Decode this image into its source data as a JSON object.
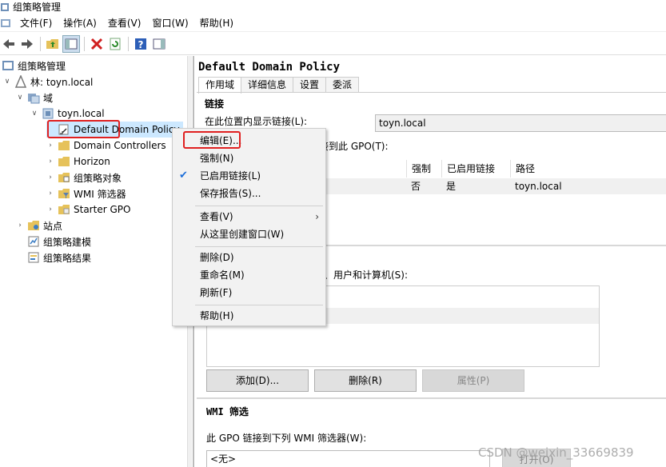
{
  "window": {
    "title": "组策略管理"
  },
  "menubar": {
    "items": [
      "文件(F)",
      "操作(A)",
      "查看(V)",
      "窗口(W)",
      "帮助(H)"
    ]
  },
  "toolbar": {
    "buttons": [
      "back-icon",
      "forward-icon",
      "up-folder-icon",
      "show-hide-tree-icon",
      "delete-icon",
      "refresh-icon",
      "help-icon",
      "properties-pane-icon"
    ]
  },
  "tree": {
    "root": "组策略管理",
    "forest": "林: toyn.local",
    "domains": "域",
    "domain": "toyn.local",
    "selected_gpo": "Default Domain Policy",
    "children": [
      "Domain Controllers",
      "Horizon",
      "组策略对象",
      "WMI 筛选器",
      "Starter GPO"
    ],
    "sites": "站点",
    "modeling": "组策略建模",
    "results": "组策略结果"
  },
  "gpo": {
    "title": "Default Domain Policy",
    "tabs": [
      "作用域",
      "详细信息",
      "设置",
      "委派"
    ],
    "links_heading": "链接",
    "show_links_label": "在此位置内显示链接(L):",
    "show_links_value": "toyn.local",
    "linked_to_label": "接到此 GPO(T):",
    "columns": [
      "强制",
      "已启用链接",
      "路径"
    ],
    "rows": [
      {
        "enforced": "否",
        "enabled": "是",
        "path": "toyn.local"
      }
    ],
    "security_filter_label": "列组、用户和计算机(S):",
    "buttons": {
      "add": "添加(D)...",
      "remove": "删除(R)",
      "properties": "属性(P)"
    },
    "wmi_heading": "WMI 筛选",
    "wmi_label": "此 GPO 链接到下列 WMI 筛选器(W):",
    "wmi_value": "<无>",
    "open_button": "打开(O)"
  },
  "context_menu": {
    "items": [
      {
        "label": "编辑(E)...",
        "checked": false,
        "submenu": false
      },
      {
        "label": "强制(N)",
        "checked": false,
        "submenu": false
      },
      {
        "label": "已启用链接(L)",
        "checked": true,
        "submenu": false
      },
      {
        "label": "保存报告(S)...",
        "checked": false,
        "submenu": false
      },
      {
        "label": "查看(V)",
        "checked": false,
        "submenu": true
      },
      {
        "label": "从这里创建窗口(W)",
        "checked": false,
        "submenu": false
      },
      {
        "label": "删除(D)",
        "checked": false,
        "submenu": false
      },
      {
        "label": "重命名(M)",
        "checked": false,
        "submenu": false
      },
      {
        "label": "刷新(F)",
        "checked": false,
        "submenu": false
      },
      {
        "label": "帮助(H)",
        "checked": false,
        "submenu": false
      }
    ]
  },
  "watermark": "CSDN @weixin_33669839",
  "colors": {
    "highlight": "#e02020",
    "check": "#1e6fd9"
  }
}
